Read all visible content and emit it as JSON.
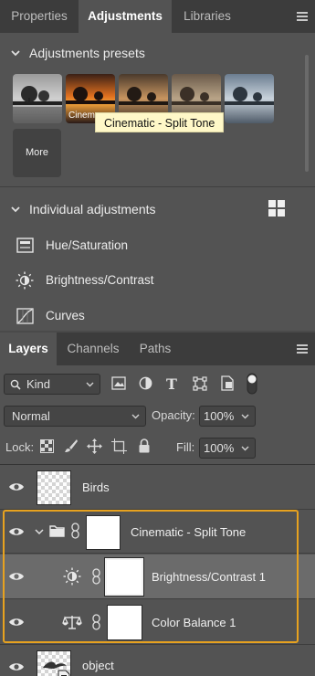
{
  "top_tabs": [
    "Properties",
    "Adjustments",
    "Libraries"
  ],
  "active_top_tab": "Adjustments",
  "presets_section": {
    "title": "Adjustments presets",
    "items": [
      {
        "label": "",
        "name": "monochrome"
      },
      {
        "label": "Cinem",
        "name": "cinematic-split-tone"
      },
      {
        "label": "",
        "name": "warm"
      },
      {
        "label": "",
        "name": "faded"
      },
      {
        "label": "",
        "name": "cool"
      }
    ],
    "more_label": "More",
    "tooltip": "Cinematic - Split Tone"
  },
  "individual_section": {
    "title": "Individual adjustments",
    "items": [
      "Hue/Saturation",
      "Brightness/Contrast",
      "Curves"
    ]
  },
  "layers_tabs": [
    "Layers",
    "Channels",
    "Paths"
  ],
  "active_layers_tab": "Layers",
  "filter": {
    "kind_label": "Kind"
  },
  "blend": {
    "mode": "Normal",
    "opacity_label": "Opacity:",
    "opacity_value": "100%"
  },
  "lock": {
    "label": "Lock:",
    "fill_label": "Fill:",
    "fill_value": "100%"
  },
  "layers": [
    {
      "name": "Birds",
      "type": "pixel"
    },
    {
      "name": "Cinematic - Split Tone",
      "type": "group"
    },
    {
      "name": "Brightness/Contrast 1",
      "type": "adjustment",
      "icon": "brightness-icon",
      "selected": true
    },
    {
      "name": "Color Balance 1",
      "type": "adjustment",
      "icon": "color-balance-icon"
    },
    {
      "name": "object",
      "type": "smart"
    }
  ],
  "colors": {
    "group_highlight": "#e7a21f",
    "tooltip_bg": "#fff8c8",
    "panel_bg": "#535353"
  }
}
